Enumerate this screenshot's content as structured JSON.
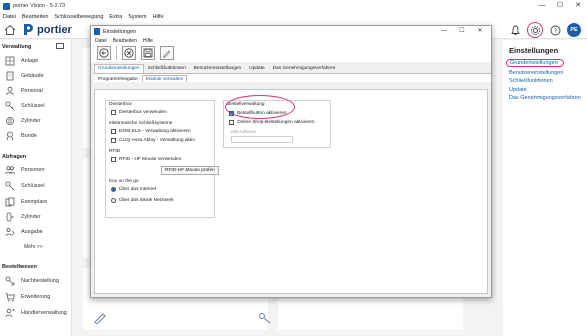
{
  "app": {
    "title": "portier Vision - 5.2.73",
    "menu": [
      "Datei",
      "Bearbeiten",
      "Schlüsselbewegung",
      "Extra",
      "System",
      "Hilfe"
    ],
    "brand": "portier",
    "avatar_initials": "PE",
    "window_controls": [
      "—",
      "☐",
      "✕"
    ]
  },
  "sidebar": {
    "section1": "Verwaltung",
    "items1": [
      "Anlage",
      "Gebäude",
      "Personal",
      "Schlüssel",
      "Zylinder",
      "Bunde"
    ],
    "section2": "Abfragen",
    "items2": [
      "Personen",
      "Schlüssel",
      "Exemplare",
      "Zylinder",
      "Ausgabe"
    ],
    "more": "Mehr >>",
    "section3": "Bestellwesen",
    "items3": [
      "Nachbestellung",
      "Erweiterung",
      "Händlerverwaltung"
    ]
  },
  "right_panel": {
    "title": "Einstellungen",
    "links": [
      "Grundeinstellungen",
      "Benutzereinstellungen",
      "Schließfunktionen",
      "Update",
      "Das Genehmigungsverfahren"
    ]
  },
  "dialog": {
    "title": "Einstellungen",
    "menu": [
      "Datei",
      "Bearbeiten",
      "Hilfe"
    ],
    "tabs_row1": [
      "Grundeinstellungen",
      "Schließfunktionen",
      "Benutzereinstellungen",
      "Update",
      "Das Genehmigungsverfahren"
    ],
    "tabs_row2": [
      "Programmfreigabe",
      "Module verwalten"
    ],
    "deisterbox": {
      "title": "Deisterbox",
      "option": "Deisterbox verwenden"
    },
    "schliess": {
      "title": "elektronische Schließsysteme",
      "options": [
        "DOM-ELS - Verwaltung aktivieren",
        "CLIQ-Assa Abloy - Verwaltung aktiv"
      ]
    },
    "rfid": {
      "title": "RFID",
      "option": "RFID - HF Mouse verwenden",
      "button": "RFID-HF Mouse prüfen"
    },
    "keyonthego": {
      "title": "Key on the go",
      "options": [
        "Über das Internet",
        "Über das lokale Netzwerk"
      ]
    },
    "bestellverwaltung": {
      "title": "Bestellverwaltung",
      "options": [
        "Bestellbutton aktivieren",
        "Online Shop-Bestellungen aktivieren"
      ],
      "email_label": "eID-Adresse"
    }
  }
}
